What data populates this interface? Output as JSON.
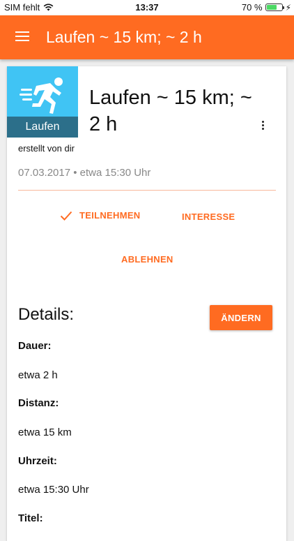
{
  "status": {
    "carrier": "SIM fehlt",
    "time": "13:37",
    "battery_text": "70 %",
    "battery_level": 0.7,
    "wifi_icon": "wifi-icon",
    "charging_icon": "bolt-icon"
  },
  "app_bar": {
    "title": "Laufen ~ 15 km; ~ 2 h",
    "menu_icon": "hamburger-menu-icon"
  },
  "event": {
    "activity_label": "Laufen",
    "activity_icon": "running-person-icon",
    "title": "Laufen ~ 15 km; ~ 2 h",
    "creator": "erstellt von dir",
    "date_line": "07.03.2017 • etwa 15:30 Uhr"
  },
  "rsvp": {
    "participate": "TEILNEHMEN",
    "interest": "INTERESSE",
    "decline": "ABLEHNEN",
    "selected": "participate"
  },
  "details": {
    "heading": "Details:",
    "edit_label": "ÄNDERN",
    "items": [
      {
        "label": "Dauer:",
        "value": "etwa 2 h"
      },
      {
        "label": "Distanz:",
        "value": "etwa 15 km"
      },
      {
        "label": "Uhrzeit:",
        "value": "etwa 15:30 Uhr"
      },
      {
        "label": "Titel:",
        "value": ""
      }
    ]
  },
  "colors": {
    "accent": "#ff6b21",
    "activity_tile": "#40c4f4",
    "activity_label_bg": "#2c6f8a"
  }
}
